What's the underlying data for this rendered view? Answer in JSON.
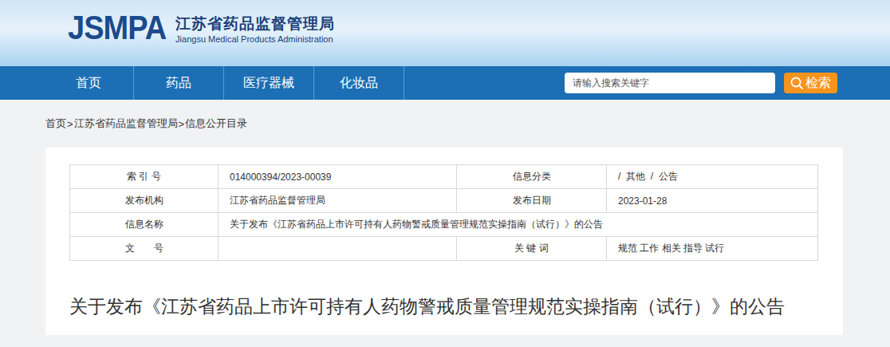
{
  "header": {
    "logo": "JSMPA",
    "site_name": "江苏省药品监督管理局",
    "site_name_en": "Jiangsu Medical Products Administration"
  },
  "nav": {
    "items": [
      "首页",
      "药品",
      "医疗器械",
      "化妆品"
    ]
  },
  "search": {
    "placeholder": "请输入搜索关键字",
    "button": "检索"
  },
  "breadcrumb": {
    "items": [
      "首页",
      "江苏省药品监督管理局",
      "信息公开目录"
    ],
    "separator": ">"
  },
  "info_table": {
    "rows": [
      [
        {
          "text": "索 引 号",
          "kind": "label"
        },
        {
          "text": "014000394/2023-00039",
          "kind": "value"
        },
        {
          "text": "信息分类",
          "kind": "label"
        },
        {
          "text": "/  其他  /  公告",
          "kind": "value"
        }
      ],
      [
        {
          "text": "发布机构",
          "kind": "label"
        },
        {
          "text": "江苏省药品监督管理局",
          "kind": "value"
        },
        {
          "text": "发布日期",
          "kind": "label"
        },
        {
          "text": "2023-01-28",
          "kind": "value"
        }
      ],
      [
        {
          "text": "信息名称",
          "kind": "label"
        },
        {
          "text": "关于发布《江苏省药品上市许可持有人药物警戒质量管理规范实操指南（试行）》的公告",
          "kind": "value"
        }
      ],
      [
        {
          "text": "文　　号",
          "kind": "label"
        },
        {
          "text": "",
          "kind": "value"
        },
        {
          "text": "关 键 词",
          "kind": "label"
        },
        {
          "text": "规范 工作 相关 指导 试行",
          "kind": "value"
        }
      ]
    ]
  },
  "article": {
    "title": "关于发布《江苏省药品上市许可持有人药物警戒质量管理规范实操指南（试行）》的公告"
  }
}
